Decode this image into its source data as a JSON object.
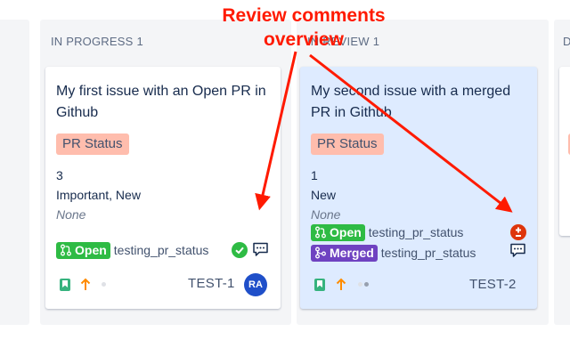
{
  "columns": [
    {
      "name": "",
      "count": ""
    },
    {
      "name": "IN PROGRESS",
      "count": "1"
    },
    {
      "name": "IN REVIEW",
      "count": "1"
    },
    {
      "name": "D",
      "count": ""
    }
  ],
  "annotation": {
    "line1": "Review comments",
    "line2": "overview",
    "color": "#ff1a00"
  },
  "cards": [
    {
      "title": "My first issue with an Open PR in Github",
      "pr_status_label": "PR Status",
      "story_points": "3",
      "labels": "Important, New",
      "fix_version": "None",
      "prs": [
        {
          "state": "Open",
          "branch": "testing_pr_status",
          "review_icon": "check-circle-icon"
        }
      ],
      "issue_key": "TEST-1",
      "assignee_initials": "RA",
      "icons": [
        "story-bookmark-icon",
        "priority-arrow-up-icon",
        "status-dot-icon"
      ]
    },
    {
      "title": "My second issue with a merged PR in Github",
      "pr_status_label": "PR Status",
      "story_points": "1",
      "labels": "New",
      "fix_version": "None",
      "prs": [
        {
          "state": "Open",
          "branch": "testing_pr_status",
          "review_icon": "changes-requested-icon"
        },
        {
          "state": "Merged",
          "branch": "testing_pr_status",
          "review_icon": "comment-icon"
        }
      ],
      "issue_key": "TEST-2",
      "icons": [
        "story-bookmark-icon",
        "priority-arrow-up-icon",
        "status-dots-icon"
      ]
    }
  ],
  "colors": {
    "open": "#2ebb44",
    "merged": "#6f42c1",
    "pr_badge_bg": "#ffbdad",
    "selected_card_bg": "#deebff",
    "avatar_bg": "#1f4fc9"
  }
}
